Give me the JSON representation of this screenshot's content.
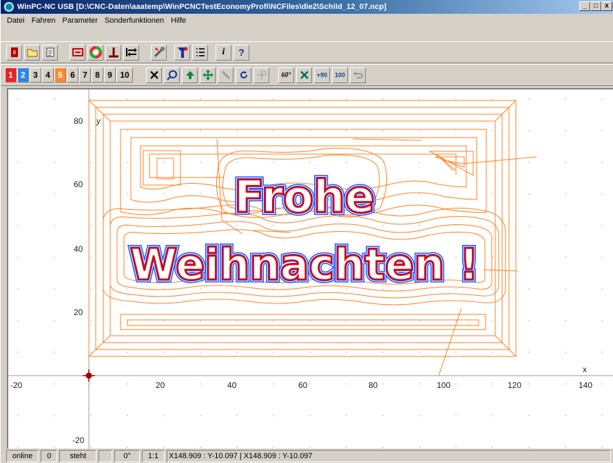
{
  "window": {
    "title": "WinPC-NC USB [D:\\CNC-Daten\\aaatemp\\WinPCNCTestEconomyProfi\\NCFiles\\die2\\Schild_12_07.ncp]",
    "controls": {
      "minimize": "_",
      "maximize": "□",
      "close": "x"
    }
  },
  "menubar": {
    "items": [
      "Datei",
      "Fahren",
      "Parameter",
      "Sonderfunktionen",
      "Hilfe"
    ]
  },
  "toolbar1": {
    "buttons": [
      {
        "name": "exit-icon",
        "glyph": "▮"
      },
      {
        "name": "open-file-icon",
        "glyph": "🗁"
      },
      {
        "name": "file-info-icon",
        "glyph": "🗎"
      },
      {
        "name": "zoom-fit-icon",
        "glyph": "⌗"
      },
      {
        "name": "color-wheel-icon",
        "glyph": "◍"
      },
      {
        "name": "tool-length-icon",
        "glyph": "⊥"
      },
      {
        "name": "reference-run-icon",
        "glyph": "⇆"
      },
      {
        "name": "setup-icon",
        "glyph": "⚒"
      },
      {
        "name": "filter-icon",
        "glyph": "Y"
      },
      {
        "name": "list-icon",
        "glyph": "☰"
      },
      {
        "name": "info-icon",
        "glyph": "i"
      },
      {
        "name": "help-icon",
        "glyph": "?"
      }
    ]
  },
  "toolbar2": {
    "layer_buttons": [
      {
        "label": "1",
        "color": "red"
      },
      {
        "label": "2",
        "color": "blue"
      },
      {
        "label": "3",
        "color": ""
      },
      {
        "label": "4",
        "color": ""
      },
      {
        "label": "5",
        "color": "orange"
      },
      {
        "label": "6",
        "color": ""
      },
      {
        "label": "7",
        "color": ""
      },
      {
        "label": "8",
        "color": ""
      },
      {
        "label": "9",
        "color": ""
      },
      {
        "label": "10",
        "color": ""
      }
    ],
    "tool_buttons": [
      {
        "name": "clear-icon",
        "glyph": "✕"
      },
      {
        "name": "magnifier-icon",
        "glyph": "⌕"
      },
      {
        "name": "move-up-icon",
        "glyph": "⇧"
      },
      {
        "name": "pan-icon",
        "glyph": "✥"
      },
      {
        "name": "line-tool-icon",
        "glyph": "╲"
      },
      {
        "name": "rotate-icon",
        "glyph": "↻"
      },
      {
        "name": "target-icon",
        "glyph": "⌖"
      },
      {
        "name": "sixty-degree-icon",
        "glyph": "60°"
      },
      {
        "name": "mirror-icon",
        "glyph": "✕"
      },
      {
        "name": "rotate-90-icon",
        "glyph": "+90"
      },
      {
        "name": "scale-100-icon",
        "glyph": "100"
      },
      {
        "name": "undo-icon",
        "glyph": "↶"
      }
    ]
  },
  "canvas": {
    "x_axis_label": "x",
    "y_axis_label": "y",
    "x_ticks": [
      -20,
      20,
      40,
      60,
      80,
      100,
      120,
      140
    ],
    "y_ticks": [
      80,
      60,
      40,
      20,
      -20
    ],
    "text_line1": "Frohe",
    "text_line2": "Weihnachten !",
    "colors": {
      "toolpath": "#ff7f1f",
      "outline": "#e00000",
      "inner": "#1f4fff",
      "axis": "#808080",
      "background": "#ffffff"
    },
    "origin_marker": "crosshair-icon"
  },
  "statusbar": {
    "cells": [
      "online",
      "0",
      "steht",
      "",
      "0°",
      "1:1",
      "X148.909 : Y-10.097  |  X148.909 : Y-10.097"
    ]
  }
}
